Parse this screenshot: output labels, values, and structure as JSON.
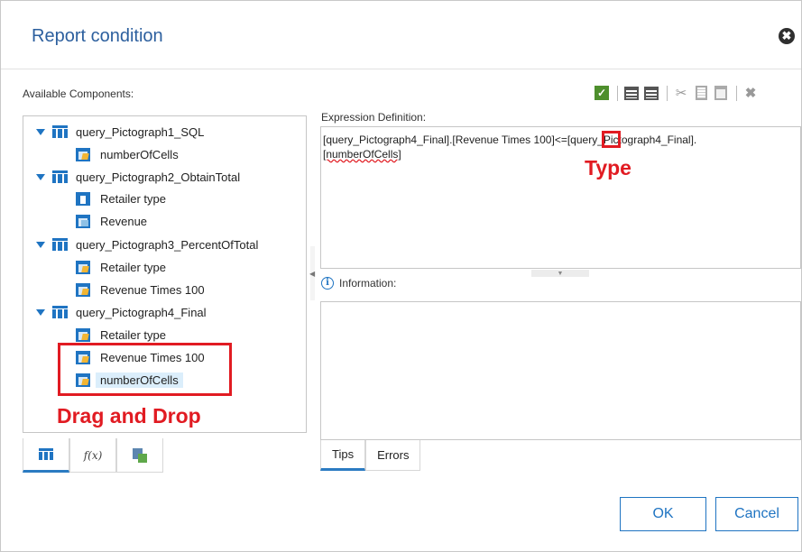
{
  "dialog": {
    "title": "Report condition",
    "close_glyph": "✖"
  },
  "left_panel": {
    "label": "Available Components:",
    "tree": [
      {
        "name": "query_Pictograph1_SQL",
        "children": [
          "numberOfCells"
        ]
      },
      {
        "name": "query_Pictograph2_ObtainTotal",
        "children": [
          "Retailer type",
          "Revenue"
        ]
      },
      {
        "name": "query_Pictograph3_PercentOfTotal",
        "children": [
          "Retailer type",
          "Revenue Times 100"
        ]
      },
      {
        "name": "query_Pictograph4_Final",
        "children": [
          "Retailer type",
          "Revenue Times 100",
          "numberOfCells"
        ]
      }
    ],
    "selected_item": "numberOfCells",
    "tabs": [
      "data-items-icon",
      "function-fx-icon",
      "calculation-icon"
    ],
    "fx_glyph": "f(x)"
  },
  "toolbar": {
    "icons": [
      "validate-check-icon",
      "expand-lines-icon",
      "collapse-lines-icon",
      "cut-icon",
      "copy-icon",
      "paste-icon",
      "delete-icon"
    ]
  },
  "expression": {
    "label": "Expression Definition:",
    "part1": "[query_Pictograph4_Final].[Revenue Times 100]",
    "operator": "<=",
    "part2": "[query_Pictograph4_Final].",
    "part3": "[numberOfCells]"
  },
  "information": {
    "label": "Information:",
    "icon_glyph": "i"
  },
  "bottom_tabs": {
    "tips": "Tips",
    "errors": "Errors"
  },
  "annotations": {
    "drag_and_drop": "Drag and Drop",
    "type": "Type",
    "annotation_color": "#e11b22"
  },
  "buttons": {
    "ok": "OK",
    "cancel": "Cancel"
  },
  "colors": {
    "accent": "#1f74c2",
    "title": "#2c5f9e"
  }
}
